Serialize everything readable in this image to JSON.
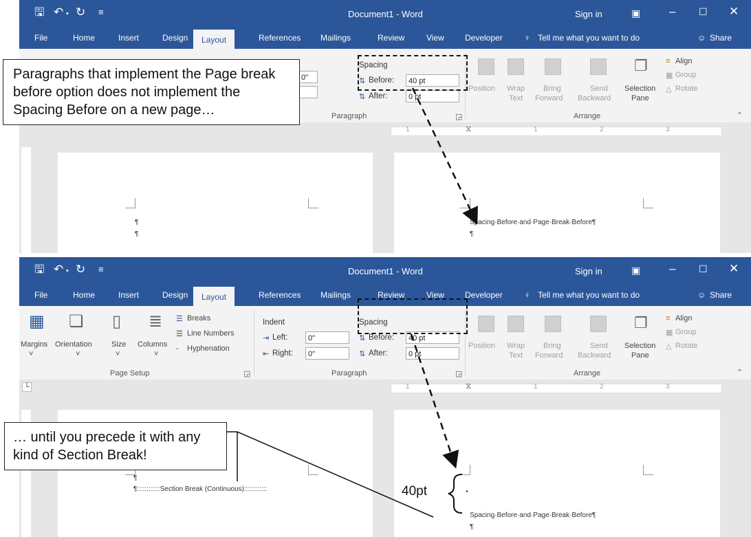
{
  "app": {
    "title": "Document1 - Word",
    "sign_in": "Sign in",
    "share": "Share"
  },
  "tabs": [
    "File",
    "Home",
    "Insert",
    "Design",
    "Layout",
    "References",
    "Mailings",
    "Review",
    "View",
    "Developer"
  ],
  "tell_me": "Tell me what you want to do",
  "page_setup": {
    "margins": "Margins",
    "orientation": "Orientation",
    "size": "Size",
    "columns": "Columns",
    "breaks": "Breaks",
    "line_numbers": "Line Numbers",
    "hyphenation": "Hyphenation",
    "group_label": "Page Setup"
  },
  "paragraph": {
    "indent": "Indent",
    "left": "Left:",
    "right": "Right:",
    "left_value": "0\"",
    "right_value": "0\"",
    "spacing": "Spacing",
    "before": "Before:",
    "after": "After:",
    "before_value": "40 pt",
    "after_value": "0 pt",
    "group_label": "Paragraph"
  },
  "arrange": {
    "position": "Position",
    "wrap": "Wrap",
    "text": "Text",
    "bring": "Bring",
    "forward": "Forward",
    "send": "Send",
    "backward": "Backward",
    "selection": "Selection",
    "pane": "Pane",
    "align": "Align",
    "group": "Group",
    "rotate": "Rotate",
    "group_label": "Arrange"
  },
  "ruler": {
    "tick_labels": [
      "1",
      "1",
      "2",
      "3"
    ]
  },
  "document": {
    "pilcrow": "¶",
    "paragraph_text": "Spacing·Before·and·Page·Break·Before¶",
    "section_break": "¶::::::::::::Section Break (Continuous)::::::::::::"
  },
  "annotations": {
    "callout_top": "Paragraphs that implement  the Page break before option does not implement the Spacing Before on a new page…",
    "callout_bottom": "… until you precede it with any kind of Section Break!",
    "spacing_label": "40pt"
  }
}
